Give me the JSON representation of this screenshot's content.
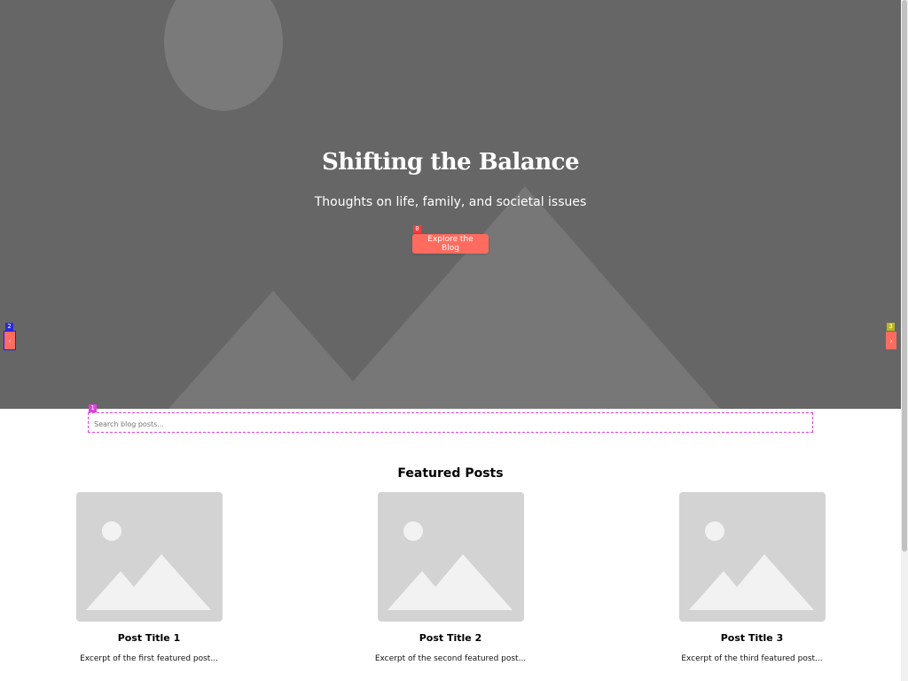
{
  "hero": {
    "title": "Shifting the Balance",
    "subtitle": "Thoughts on life, family, and societal issues",
    "cta_label": "Explore the Blog",
    "prev_arrow": "‹",
    "next_arrow": "›",
    "image_icon": "landscape-placeholder-icon"
  },
  "annotations": {
    "cta_badge": "0",
    "search_badge": "1",
    "prev_badge": "2",
    "next_badge": "3"
  },
  "search": {
    "placeholder": "Search blog posts...",
    "value": ""
  },
  "featured": {
    "heading": "Featured Posts",
    "posts": [
      {
        "title": "Post Title 1",
        "excerpt": "Excerpt of the first featured post..."
      },
      {
        "title": "Post Title 2",
        "excerpt": "Excerpt of the second featured post..."
      },
      {
        "title": "Post Title 3",
        "excerpt": "Excerpt of the third featured post..."
      }
    ]
  },
  "colors": {
    "accent": "#ff6b5e",
    "hero_bg": "#666666",
    "placeholder_bg": "#d3d3d3"
  }
}
